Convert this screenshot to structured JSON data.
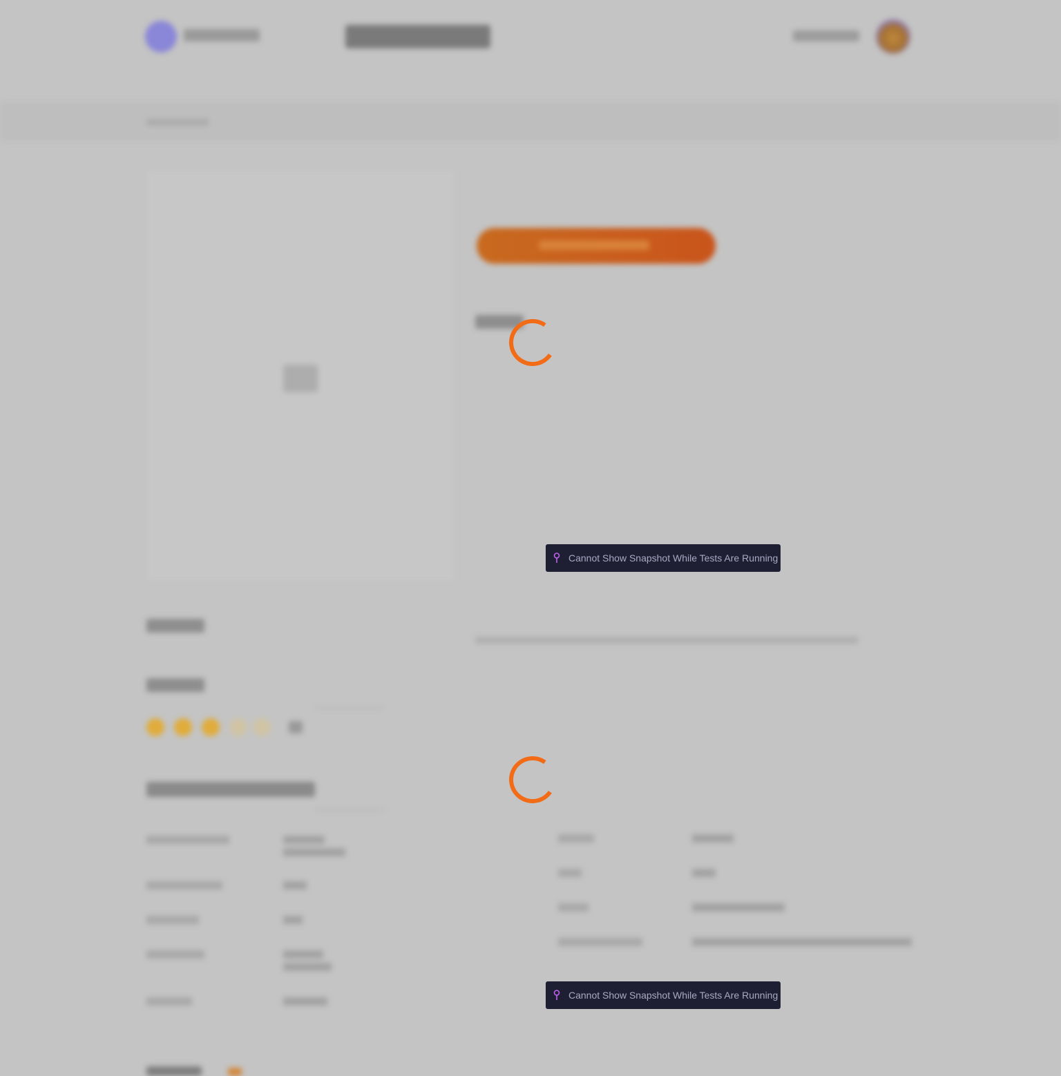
{
  "header": {
    "brand_icon": "logo-icon",
    "avatar_icon": "user-avatar-icon"
  },
  "product": {
    "image_icon": "image-placeholder-icon",
    "rating": {
      "value": 3,
      "max": 5,
      "star_color": "#f0b020"
    }
  },
  "loading": {
    "spinner_color": "#f26b17",
    "spinner_icon": "loading-spinner-icon"
  },
  "toasts": [
    {
      "message": "Cannot Show Snapshot While Tests Are Running",
      "icon": "pin-icon",
      "icon_color": "#c060f0"
    },
    {
      "message": "Cannot Show Snapshot While Tests Are Running",
      "icon": "pin-icon",
      "icon_color": "#c060f0"
    }
  ],
  "colors": {
    "toast_bg": "#1e1f33",
    "toast_text": "#a9a9c3",
    "cta": "#c9541b"
  }
}
